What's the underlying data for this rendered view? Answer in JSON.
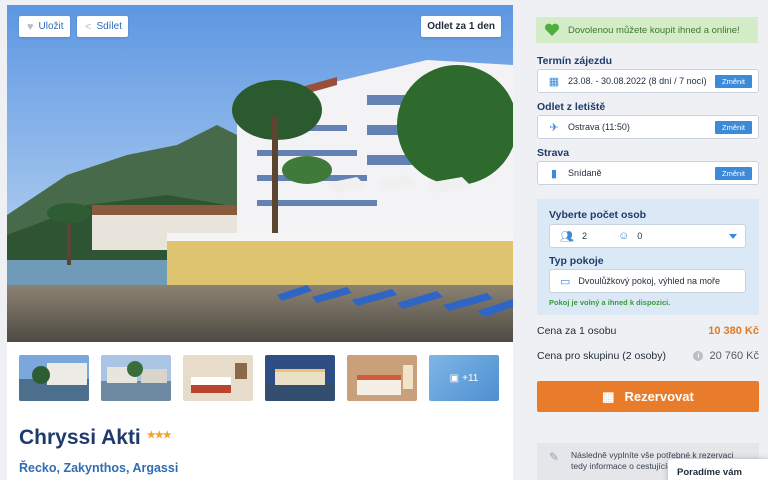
{
  "gallery": {
    "save_label": "Uložit",
    "share_label": "Sdílet",
    "departure_badge": "Odlet za 1 den",
    "more_photos": "+11"
  },
  "hotel": {
    "name": "Chryssi Akti",
    "stars": 3,
    "stars_text": "★★★",
    "location": "Řecko, Zakynthos, Argassi"
  },
  "booking": {
    "notice": "Dovolenou můžete koupit ihned a online!",
    "term_label": "Termín zájezdu",
    "term_value": "23.08. - 30.08.2022 (8 dní / 7 nocí)",
    "airport_label": "Odlet z letiště",
    "airport_value": "Ostrava (11:50)",
    "board_label": "Strava",
    "board_value": "Snídaně",
    "change_label": "Změnit",
    "persons_label": "Vyberte počet osob",
    "adults": "2",
    "children": "0",
    "room_label": "Typ pokoje",
    "room_value": "Dvoulůžkový pokoj, výhled na moře",
    "room_note": "Pokoj je volný a ihned k dispozici.",
    "price_person_label": "Cena za 1 osobu",
    "price_person_value": "10 380 Kč",
    "price_group_label": "Cena pro skupinu (2 osoby)",
    "price_group_value": "20 760 Kč",
    "reserve_label": "Rezervovat",
    "next_note": "Následně vyplníte vše potřebné k rezervaci tedy informace o cestujících a způsob platby."
  },
  "help": {
    "label": "Poradíme vám"
  },
  "colors": {
    "accent_blue": "#3c8ad8",
    "title_navy": "#1f3a6b",
    "orange": "#e87c2a",
    "success_green": "#3a7a2f"
  }
}
